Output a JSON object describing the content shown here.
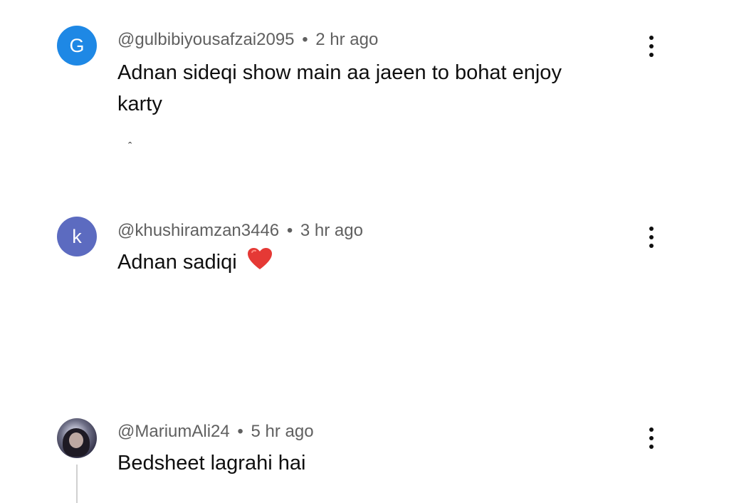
{
  "comments": [
    {
      "avatar_letter": "G",
      "avatar_color": "#1e88e5",
      "handle": "@gulbibiyousafzai2095",
      "separator": "•",
      "time": "2 hr ago",
      "text": "Adnan sideqi show main aa jaeen to bohat enjoy karty ",
      "menu_icon": "more-vert-icon"
    },
    {
      "avatar_letter": "k",
      "avatar_color": "#5c6bc0",
      "handle": "@khushiramzan3446",
      "separator": "•",
      "time": "3 hr ago",
      "text": "Adnan sadiqi",
      "emoji_icon": "red-heart-icon",
      "menu_icon": "more-vert-icon"
    },
    {
      "avatar_letter": "",
      "handle": "@MariumAli24",
      "separator": "•",
      "time": "5 hr ago",
      "text": "Bedsheet lagrahi hai",
      "menu_icon": "more-vert-icon"
    }
  ]
}
